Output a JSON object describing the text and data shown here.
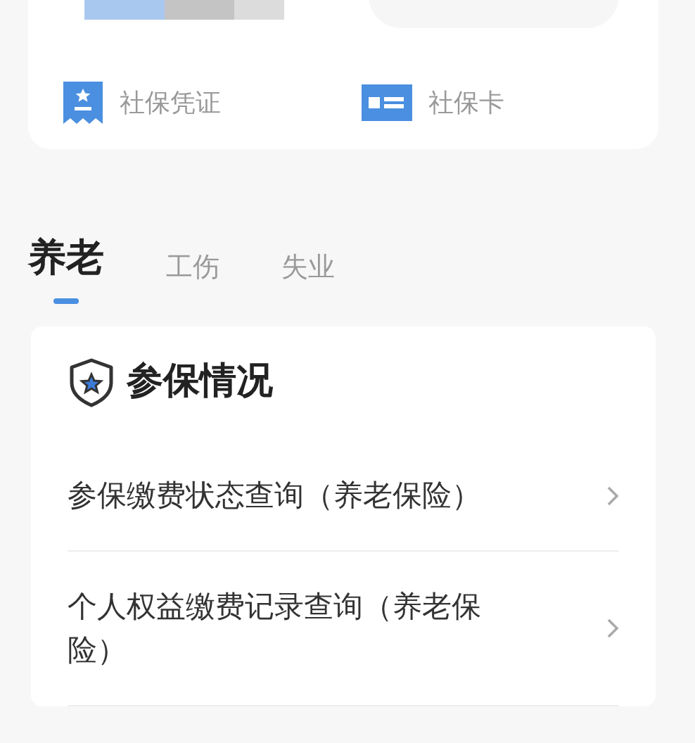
{
  "profile_card": {
    "shortcuts": [
      {
        "label": "社保凭证",
        "kind": "voucher"
      },
      {
        "label": "社保卡",
        "kind": "card"
      }
    ]
  },
  "tabs": [
    {
      "label": "养老",
      "selected": true
    },
    {
      "label": "工伤",
      "selected": false
    },
    {
      "label": "失业",
      "selected": false
    }
  ],
  "section": {
    "title": "参保情况",
    "items": [
      {
        "label": "参保缴费状态查询（养老保险）"
      },
      {
        "label": "个人权益缴费记录查询（养老保险）"
      }
    ]
  }
}
